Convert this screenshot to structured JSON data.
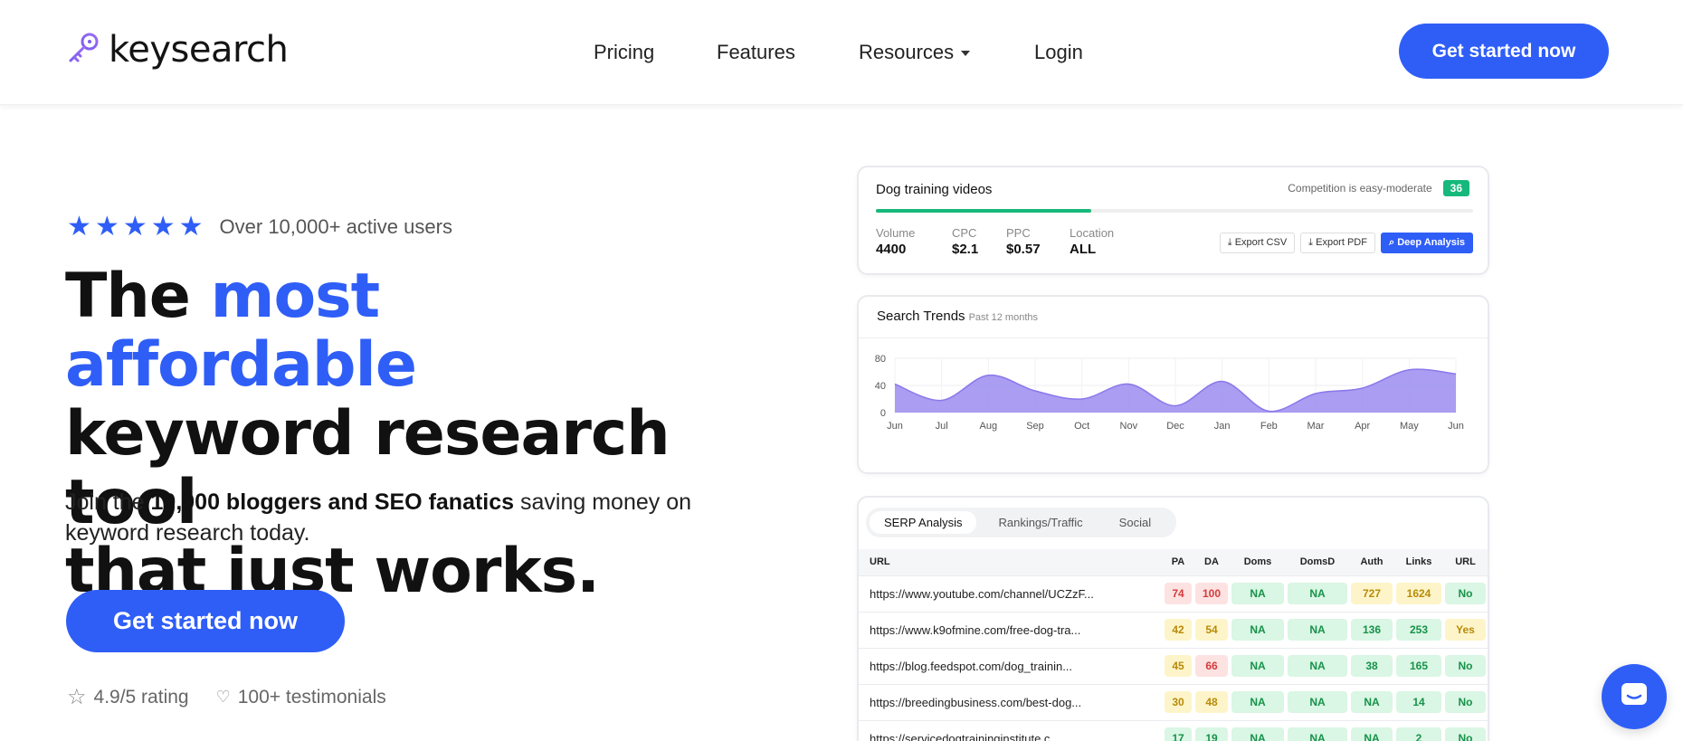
{
  "nav": {
    "brand": "keysearch",
    "items": [
      "Pricing",
      "Features",
      "Resources",
      "Login"
    ],
    "cta": "Get started now"
  },
  "hero": {
    "users_text": "Over 10,000+ active users",
    "headline_1a": "The ",
    "headline_1b": "most affordable",
    "headline_2": "keyword research tool",
    "headline_3a": "that ",
    "headline_3b": "just works",
    "headline_3c": ".",
    "sub_a": "Join the ",
    "sub_b": "10,000 bloggers and SEO fanatics",
    "sub_c": " saving money on keyword research today.",
    "cta": "Get started now",
    "rating": "4.9/5 rating",
    "testimonials": "100+ testimonials"
  },
  "keyword_card": {
    "keyword": "Dog training videos",
    "competition_label": "Competition is easy-moderate",
    "competition_score": "36",
    "competition_fraction": 0.36,
    "metrics": [
      {
        "label": "Volume",
        "value": "4400"
      },
      {
        "label": "CPC",
        "value": "$2.1"
      },
      {
        "label": "PPC",
        "value": "$0.57"
      },
      {
        "label": "Location",
        "value": "ALL"
      }
    ],
    "buttons": [
      "Export CSV",
      "Export PDF",
      "Deep Analysis"
    ]
  },
  "trends": {
    "title": "Search Trends",
    "subtitle": "Past 12 months"
  },
  "chart_data": {
    "type": "area",
    "categories": [
      "Jun",
      "Jul",
      "Aug",
      "Sep",
      "Oct",
      "Nov",
      "Dec",
      "Jan",
      "Feb",
      "Mar",
      "Apr",
      "May",
      "Jun"
    ],
    "values": [
      42,
      18,
      55,
      32,
      20,
      42,
      10,
      46,
      2,
      28,
      36,
      63,
      57
    ],
    "ylim": [
      0,
      80
    ],
    "yticks": [
      0,
      40,
      80
    ],
    "grid": true,
    "color": "#9b8cf0"
  },
  "serp": {
    "tabs": [
      "SERP Analysis",
      "Rankings/Traffic",
      "Social"
    ],
    "headers": [
      "URL",
      "PA",
      "DA",
      "Doms",
      "DomsD",
      "Auth",
      "Links",
      "URL"
    ],
    "rows": [
      {
        "url": "https://www.youtube.com/channel/UCZzF...",
        "cells": [
          [
            "74",
            "red"
          ],
          [
            "100",
            "red"
          ],
          [
            "NA",
            "green"
          ],
          [
            "NA",
            "green"
          ],
          [
            "727",
            "yellow"
          ],
          [
            "1624",
            "yellow"
          ],
          [
            "No",
            "green"
          ]
        ]
      },
      {
        "url": "https://www.k9ofmine.com/free-dog-tra...",
        "cells": [
          [
            "42",
            "yellow"
          ],
          [
            "54",
            "yellow"
          ],
          [
            "NA",
            "green"
          ],
          [
            "NA",
            "green"
          ],
          [
            "136",
            "green"
          ],
          [
            "253",
            "green"
          ],
          [
            "Yes",
            "yellow"
          ]
        ]
      },
      {
        "url": "https://blog.feedspot.com/dog_trainin...",
        "cells": [
          [
            "45",
            "yellow"
          ],
          [
            "66",
            "red"
          ],
          [
            "NA",
            "green"
          ],
          [
            "NA",
            "green"
          ],
          [
            "38",
            "green"
          ],
          [
            "165",
            "green"
          ],
          [
            "No",
            "green"
          ]
        ]
      },
      {
        "url": "https://breedingbusiness.com/best-dog...",
        "cells": [
          [
            "30",
            "yellow"
          ],
          [
            "48",
            "yellow"
          ],
          [
            "NA",
            "green"
          ],
          [
            "NA",
            "green"
          ],
          [
            "NA",
            "green"
          ],
          [
            "14",
            "green"
          ],
          [
            "No",
            "green"
          ]
        ]
      },
      {
        "url": "https://servicedogtraininginstitute.c...",
        "cells": [
          [
            "17",
            "green"
          ],
          [
            "19",
            "green"
          ],
          [
            "NA",
            "green"
          ],
          [
            "NA",
            "green"
          ],
          [
            "NA",
            "green"
          ],
          [
            "2",
            "green"
          ],
          [
            "No",
            "green"
          ]
        ]
      }
    ]
  },
  "colors": {
    "accent": "#2f5ef7",
    "success": "#16b97b"
  }
}
